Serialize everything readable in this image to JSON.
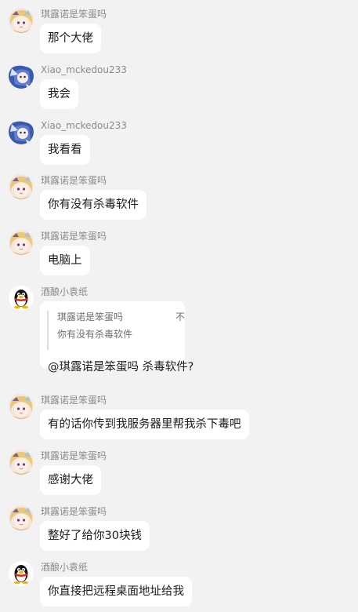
{
  "messages": [
    {
      "sender": "琪露诺是笨蛋吗",
      "avatar": "anime-girl-avatar",
      "text": "那个大佬"
    },
    {
      "sender": "Xiao_mckedou233",
      "avatar": "anime-blue-avatar",
      "text": "我会"
    },
    {
      "sender": "Xiao_mckedou233",
      "avatar": "anime-blue-avatar",
      "text": "我看看"
    },
    {
      "sender": "琪露诺是笨蛋吗",
      "avatar": "anime-girl-avatar",
      "text": "你有没有杀毒软件"
    },
    {
      "sender": "琪露诺是笨蛋吗",
      "avatar": "anime-girl-avatar",
      "text": "电脑上"
    },
    {
      "sender": "酒酿小袁纸",
      "avatar": "penguin-avatar",
      "quote": {
        "name": "琪露诺是笨蛋吗",
        "flag": "不",
        "text": "你有没有杀毒软件"
      },
      "text": "@琪露诺是笨蛋吗 杀毒软件?"
    },
    {
      "sender": "琪露诺是笨蛋吗",
      "avatar": "anime-girl-avatar",
      "text": "有的话你传到我服务器里帮我杀下毒吧"
    },
    {
      "sender": "琪露诺是笨蛋吗",
      "avatar": "anime-girl-avatar",
      "text": "感谢大佬"
    },
    {
      "sender": "琪露诺是笨蛋吗",
      "avatar": "anime-girl-avatar",
      "text": "整好了给你30块钱"
    },
    {
      "sender": "酒酿小袁纸",
      "avatar": "penguin-avatar",
      "text": "你直接把远程桌面地址给我"
    }
  ]
}
